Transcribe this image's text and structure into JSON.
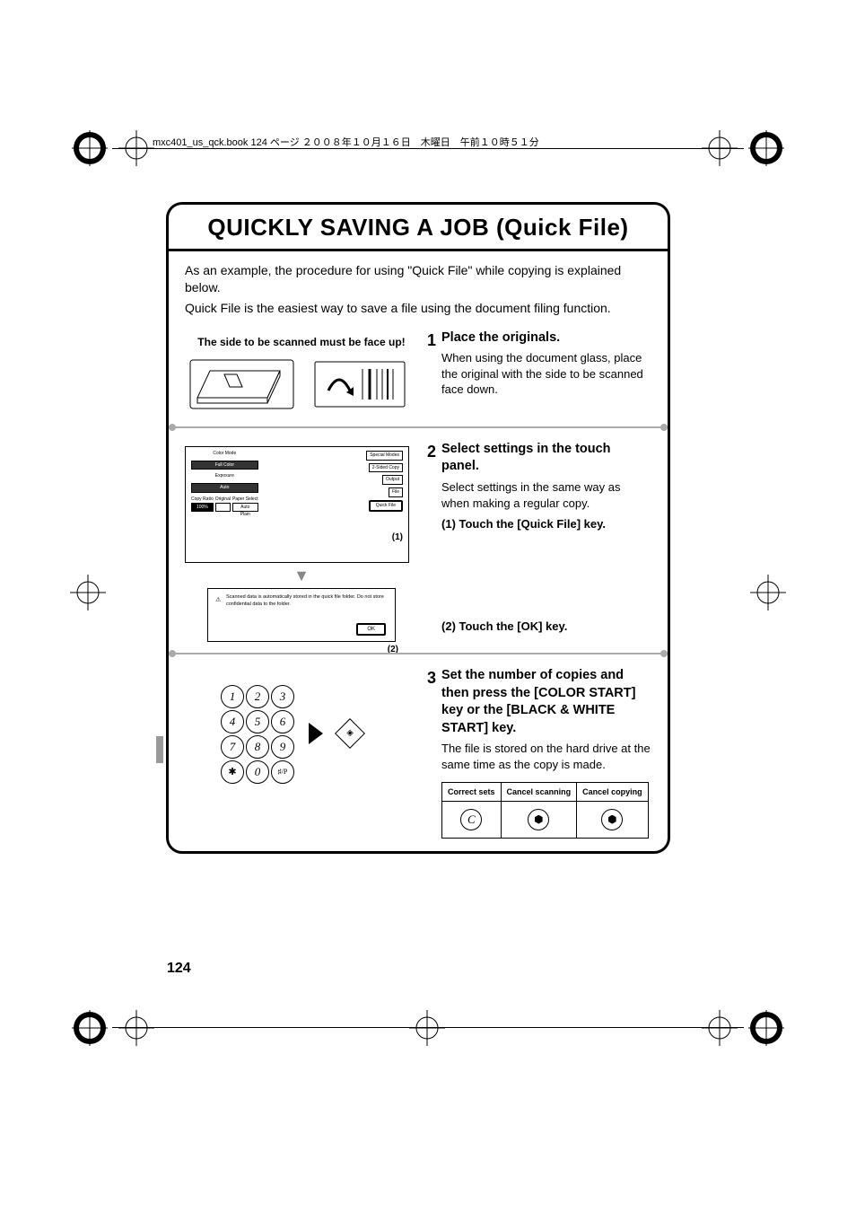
{
  "header_line": "mxc401_us_qck.book  124 ページ  ２００８年１０月１６日　木曜日　午前１０時５１分",
  "title": "QUICKLY SAVING A JOB (Quick File)",
  "intro": {
    "p1": "As an example, the procedure for using \"Quick File\" while copying is explained below.",
    "p2": "Quick File is the easiest way to save a file using the document filing function."
  },
  "face_up_note": "The side to be scanned must be face up!",
  "step1": {
    "num": "1",
    "title": "Place the originals.",
    "text": "When using the document glass, place the original with the side to be scanned face down."
  },
  "step2": {
    "num": "2",
    "title": "Select settings in the touch panel.",
    "text": "Select settings in the same way as when making a regular copy.",
    "sub1": "(1) Touch the [Quick File] key.",
    "sub2": "(2) Touch the [OK] key."
  },
  "step3": {
    "num": "3",
    "title": "Set the number of copies and then press the [COLOR START] key or the [BLACK & WHITE START] key.",
    "text": "The file is stored on the hard drive at the same time as the copy is made."
  },
  "touchpanel": {
    "color_mode": "Color Mode",
    "full_color": "Full Color",
    "exposure": "Exposure",
    "auto": "Auto",
    "copy_ratio": "Copy Ratio",
    "ratio": "100%",
    "original": "Original",
    "paper_select": "Paper Select",
    "special_modes": "Special Modes",
    "two_sided": "2-Sided Copy",
    "output": "Output",
    "file": "File",
    "quick_file": "Quick File",
    "plain": "Plain",
    "auto2": "Auto",
    "marker1": "(1)"
  },
  "dialog": {
    "text": "Scanned data is automatically stored in the quick file folder. Do not store confidential data to the folder.",
    "ok": "OK",
    "marker2": "(2)"
  },
  "keypad": [
    "1",
    "2",
    "3",
    "4",
    "5",
    "6",
    "7",
    "8",
    "9",
    "✱",
    "0",
    "♯/P"
  ],
  "cancel_table": {
    "h1": "Correct sets",
    "h2": "Cancel scanning",
    "h3": "Cancel copying",
    "c_key": "C"
  },
  "page_number": "124"
}
